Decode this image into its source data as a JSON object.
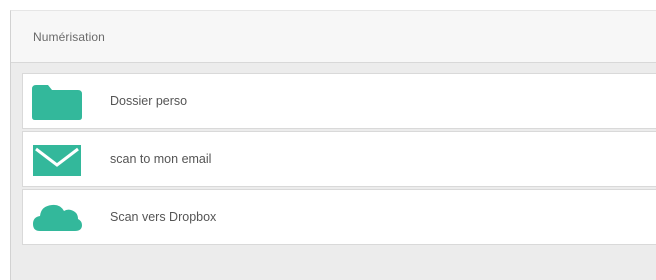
{
  "header": {
    "title": "Numérisation"
  },
  "items": [
    {
      "label": "Dossier perso",
      "icon": "folder-icon"
    },
    {
      "label": "scan to mon email",
      "icon": "envelope-icon"
    },
    {
      "label": "Scan vers Dropbox",
      "icon": "cloud-icon"
    }
  ],
  "colors": {
    "accent": "#33b89b",
    "panel_background": "#ececec",
    "header_background": "#f7f7f7",
    "item_background": "#ffffff",
    "text": "#555555"
  }
}
